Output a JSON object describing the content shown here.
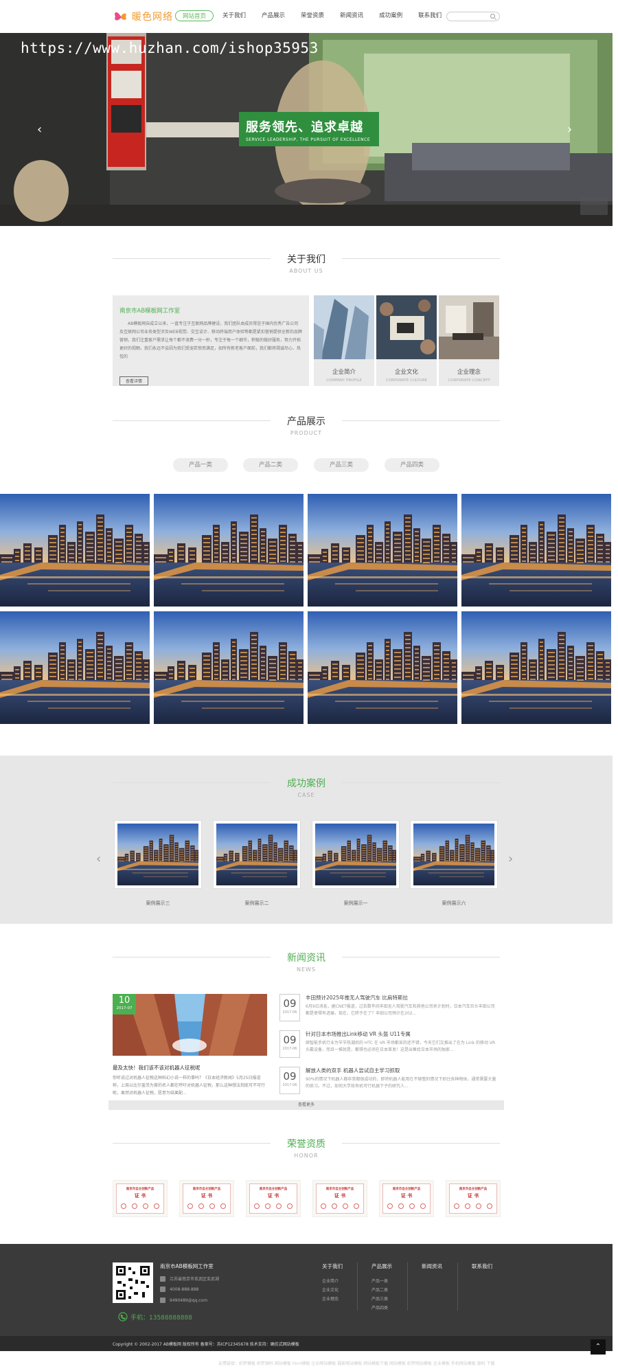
{
  "header": {
    "logo_text": "暖色网络",
    "nav": [
      "网站首页",
      "关于我们",
      "产品展示",
      "荣誉资质",
      "新闻资讯",
      "成功案例",
      "联系我们"
    ],
    "active_index": 0
  },
  "banner": {
    "watermark_url": "https://www.huzhan.com/ishop35953",
    "slogan": "服务领先、追求卓越",
    "slogan_en": "SERVICE LEADERSHIP, THE PURSUIT OF EXCELLENCE"
  },
  "about": {
    "title": "关于我们",
    "title_en": "ABOUT US",
    "company": "南京市AB模板网工作室",
    "text": "AB模板网自成立以来，一直专注于互联网品牌建设，我们团队由成员常驻于国内优秀广告公司及互联网公司业务类型涉及WEB视觉、交互设计、移动终端用户体验等都是紧扣营销提供全新的品牌营销，我们注重客户需求让每个都不浪费一分一秒，专注于每一个细节，积极的做好服务，努力开拓更好的视野。我们永远不会因为我们受宠若惊而满足，如所有新老客户面前，我们都将竭诚尽心、热忱的",
    "more": "查看详情",
    "cards": [
      {
        "cn": "企业简介",
        "en": "COMPANY PROFILE"
      },
      {
        "cn": "企业文化",
        "en": "CORPORATE CULTURE"
      },
      {
        "cn": "企业理念",
        "en": "CORPORATE CONCEPT"
      }
    ]
  },
  "products": {
    "title": "产品展示",
    "title_en": "PRODUCT",
    "tabs": [
      "产品一类",
      "产品二类",
      "产品三类",
      "产品四类"
    ]
  },
  "cases": {
    "title": "成功案例",
    "title_en": "CASE",
    "items": [
      "案例展示三",
      "案例展示二",
      "案例展示一",
      "案例展示六"
    ]
  },
  "news": {
    "title": "新闻资讯",
    "title_en": "NEWS",
    "featured": {
      "day": "10",
      "ym": "2017-07",
      "title": "最及太快！我们该不该对机器人征税呢",
      "desc": "你听说过对机器人征税这种科幻小说一样的事吗？《日本经济新闻》5月25日报道称，上周以比尔盖茨为首的名人都在呼吁对机器人征税，那么这种想法到底可不可行呢，果然对机器人征税，愿意为结果配..."
    },
    "items": [
      {
        "day": "09",
        "ym": "2017-06",
        "title": "丰田预计2025年推无人驾驶汽车 比肩特斯拉",
        "desc": "6月9日消息，据CNET报道，过去数年间丰田无人驾驶汽车和其他公司来计划时，日本汽车巨头丰田公司都是使得有进展，现在，它终于在了？丰田公司预计在202..."
      },
      {
        "day": "09",
        "ym": "2017-06",
        "title": "针对日本市场推出Link移动 VR 头盔 U11专属",
        "desc": "继智能手机行业为节节热潮后的 HTC 在 VR 市场都采的还不错，今天它们又推出了在为 Link 的移动 VR 头戴设备，而且一推就是，都得也必须在日本首发！这是出售给日本市场的独家..."
      },
      {
        "day": "09",
        "ym": "2017-06",
        "title": "解放人类的双手 机器人尝试自主学习抓取",
        "desc": "90%的情况下机器人都非常都很成功的，即将机器人能用在不够整的情况下抓住各种物体，通常需要大量的练习。不过，如何大学技有机可行机器下子的研究人..."
      }
    ],
    "more": "查看更多"
  },
  "honor": {
    "title": "荣誉资质",
    "title_en": "HONOR",
    "cert_top": "南京市自主创新产品",
    "cert_mid": "证 书",
    "count": 6
  },
  "footer": {
    "company": "南京市AB模板网工作室",
    "address": "江苏省南京市玄武区玄武湖",
    "tel": "4008-888-888",
    "email": "9490489@qq.com",
    "phone": "手机：13588888888",
    "cols": [
      {
        "head": "关于我们",
        "items": [
          "企业简介",
          "企业文化",
          "企业理念"
        ]
      },
      {
        "head": "产品展示",
        "items": [
          "产品一类",
          "产品二类",
          "产品三类",
          "产品四类"
        ]
      },
      {
        "head": "新闻资讯",
        "items": []
      },
      {
        "head": "联系我们",
        "items": []
      }
    ],
    "copyright": "Copyright © 2002-2017 AB模板网 版权所有 备案号：苏ICP12345678 技术支持：确仿式网站模板",
    "links": "友情链接：织梦模板 织梦源码 网站模板 html模板 企业网站模板 摄影网站模板 网站模板下载 网站模板 织梦网站模板 企业模板 手机网站模板 源码 下载"
  },
  "colors": {
    "accent": "#4caf50",
    "footer_bg": "#3a3a3a"
  }
}
